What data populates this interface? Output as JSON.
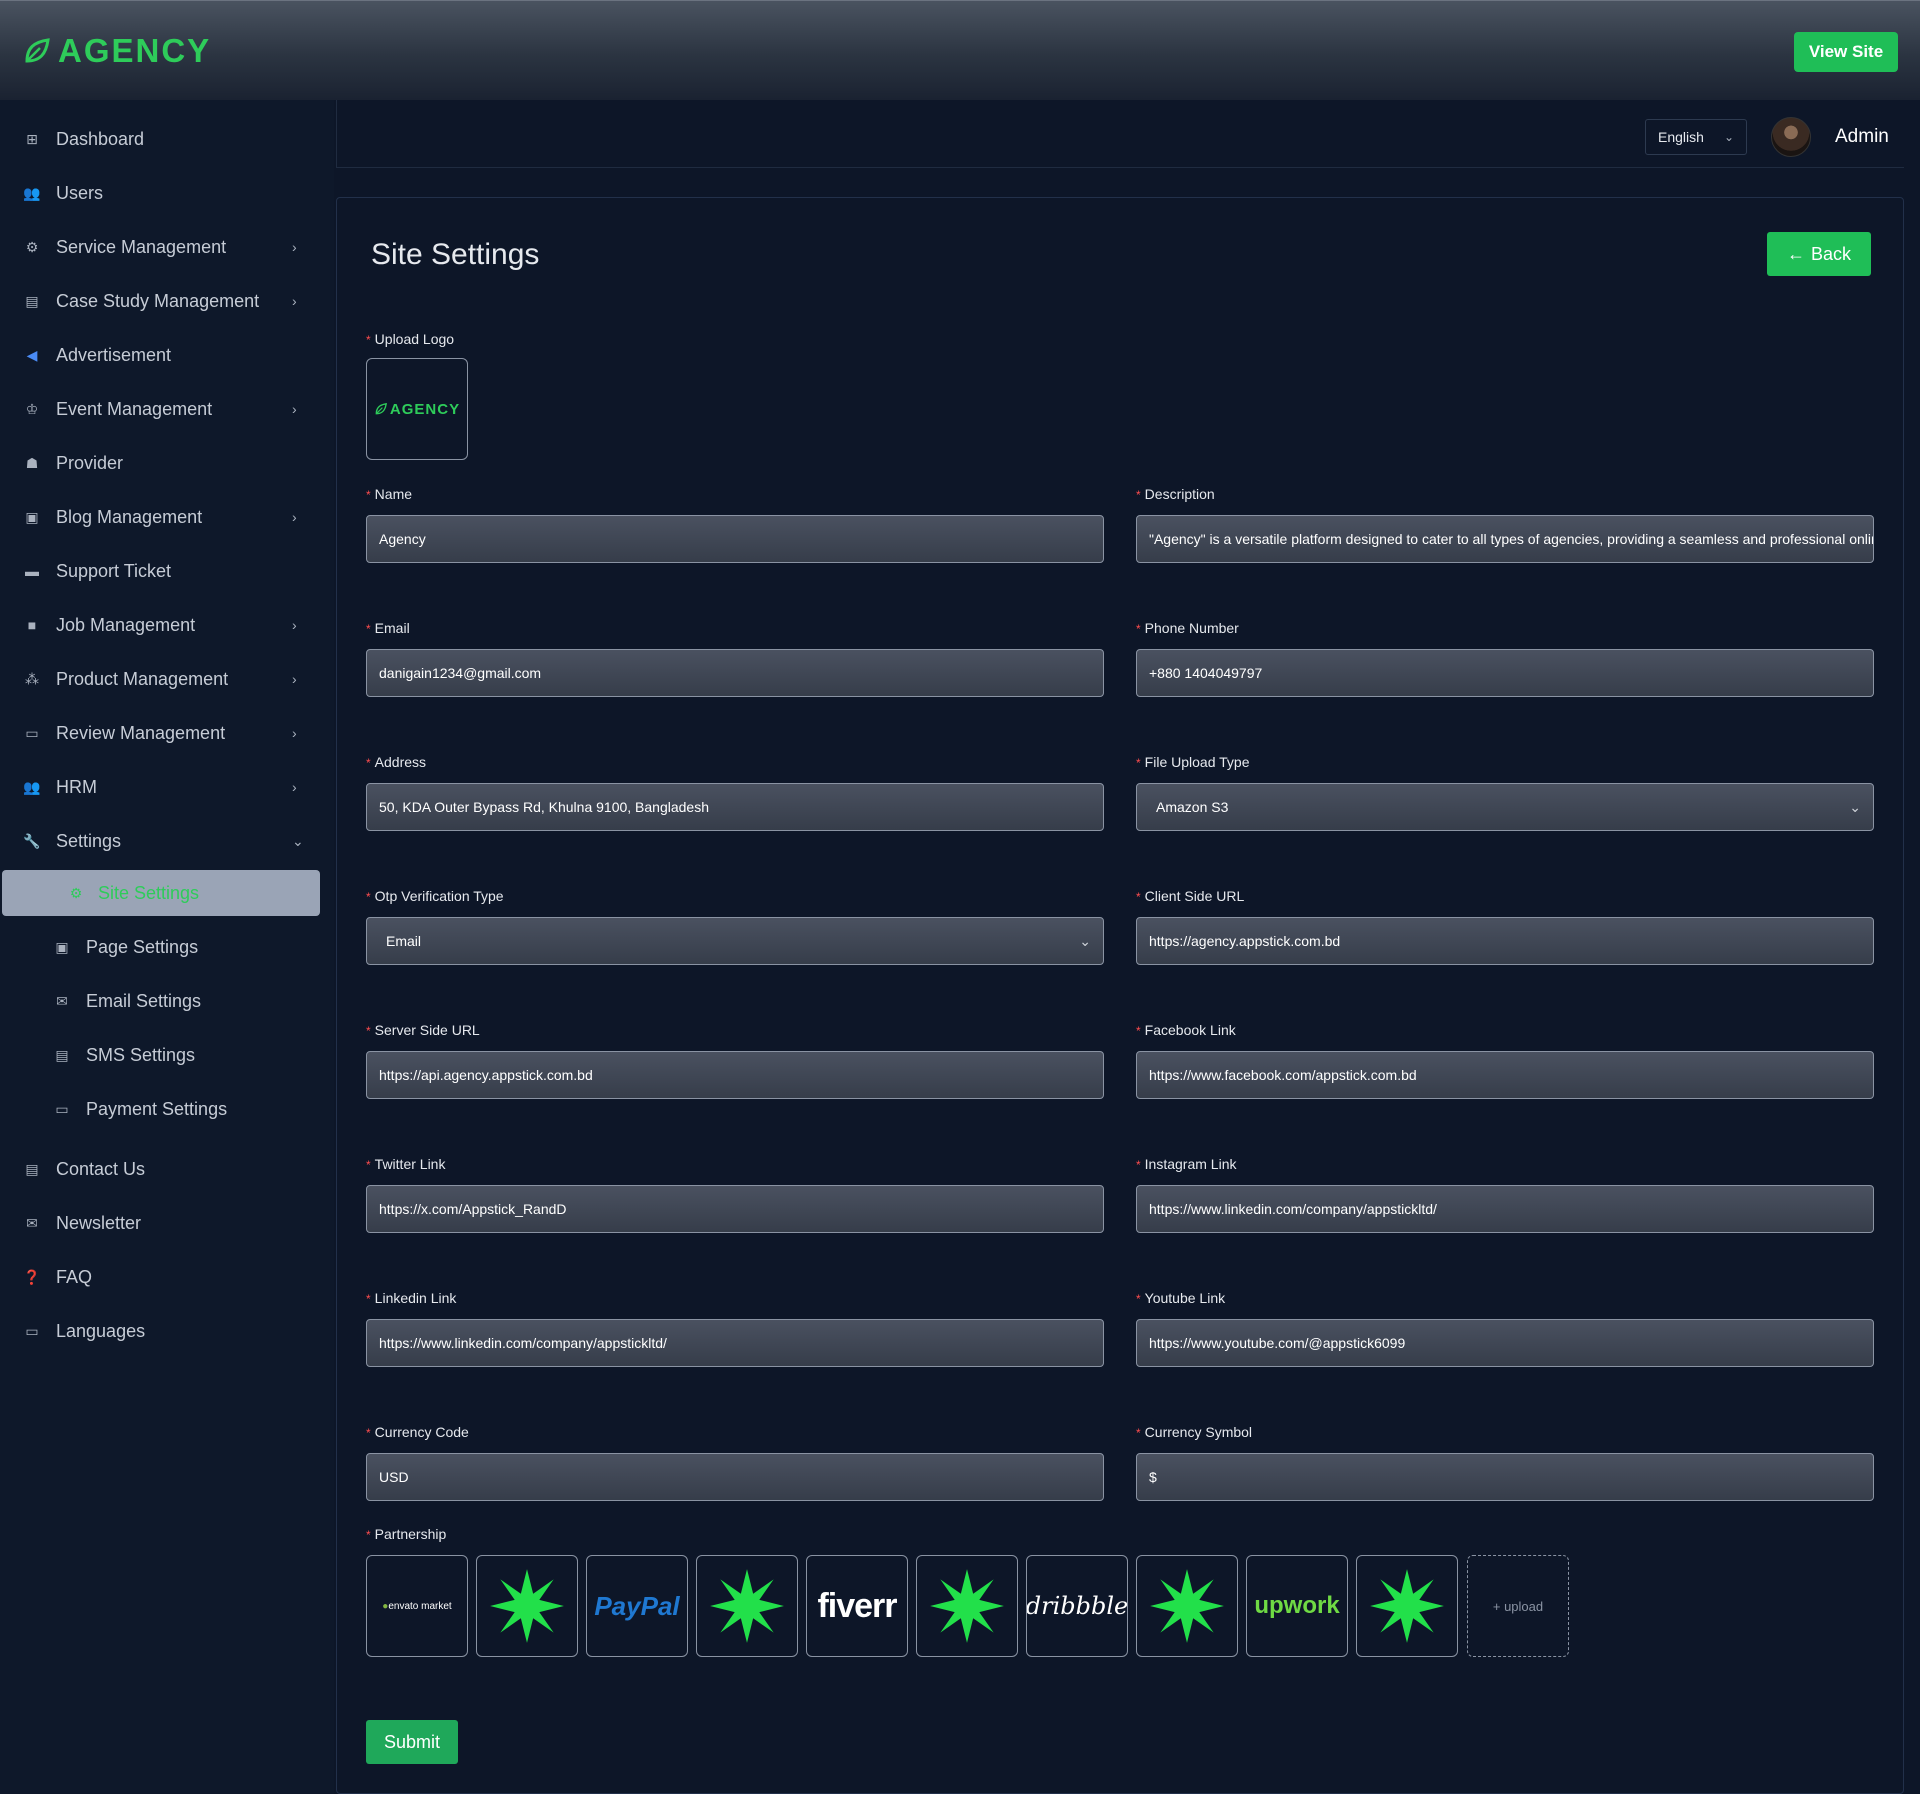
{
  "brand": {
    "name": "AGENCY",
    "color": "#2ecc5a"
  },
  "topbar": {
    "view_site": "View Site"
  },
  "sidebar": {
    "items": [
      {
        "label": "Dashboard",
        "icon": "dashboard-icon"
      },
      {
        "label": "Users",
        "icon": "users-icon"
      },
      {
        "label": "Service Management",
        "icon": "service-icon",
        "chevron": true
      },
      {
        "label": "Case Study Management",
        "icon": "document-icon",
        "chevron": true
      },
      {
        "label": "Advertisement",
        "icon": "megaphone-icon"
      },
      {
        "label": "Event Management",
        "icon": "trophy-icon",
        "chevron": true
      },
      {
        "label": "Provider",
        "icon": "provider-icon"
      },
      {
        "label": "Blog Management",
        "icon": "blog-icon",
        "chevron": true
      },
      {
        "label": "Support Ticket",
        "icon": "ticket-icon"
      },
      {
        "label": "Job Management",
        "icon": "briefcase-icon",
        "chevron": true
      },
      {
        "label": "Product Management",
        "icon": "product-icon",
        "chevron": true
      },
      {
        "label": "Review Management",
        "icon": "review-icon",
        "chevron": true
      },
      {
        "label": "HRM",
        "icon": "team-icon",
        "chevron": true
      },
      {
        "label": "Settings",
        "icon": "wrench-icon",
        "chevron": true
      }
    ],
    "settings_sub": [
      {
        "label": "Site Settings",
        "icon": "gear-icon",
        "active": true
      },
      {
        "label": "Page Settings",
        "icon": "page-icon"
      },
      {
        "label": "Email Settings",
        "icon": "email-icon"
      },
      {
        "label": "SMS Settings",
        "icon": "sms-icon"
      },
      {
        "label": "Payment Settings",
        "icon": "card-icon"
      }
    ],
    "bottom": [
      {
        "label": "Contact Us",
        "icon": "contact-icon"
      },
      {
        "label": "Newsletter",
        "icon": "mail-icon"
      },
      {
        "label": "FAQ",
        "icon": "question-icon"
      },
      {
        "label": "Languages",
        "icon": "languages-icon"
      }
    ]
  },
  "header": {
    "language": "English",
    "user": "Admin"
  },
  "page": {
    "title": "Site Settings",
    "back": "Back",
    "upload_logo_label": "Upload Logo",
    "logo_text": "AGENCY",
    "fields": {
      "name": {
        "label": "Name",
        "value": "Agency"
      },
      "description": {
        "label": "Description",
        "value": "\"Agency\" is a versatile platform designed to cater to all types of agencies, providing a seamless and professional online"
      },
      "email": {
        "label": "Email",
        "value": "danigain1234@gmail.com"
      },
      "phone": {
        "label": "Phone Number",
        "value": "+880 1404049797"
      },
      "address": {
        "label": "Address",
        "value": "50, KDA Outer Bypass Rd, Khulna 9100, Bangladesh"
      },
      "file_upload_type": {
        "label": "File Upload Type",
        "value": "Amazon S3"
      },
      "otp_type": {
        "label": "Otp Verification Type",
        "value": "Email"
      },
      "client_url": {
        "label": "Client Side URL",
        "value": "https://agency.appstick.com.bd"
      },
      "server_url": {
        "label": "Server Side URL",
        "value": "https://api.agency.appstick.com.bd"
      },
      "facebook": {
        "label": "Facebook Link",
        "value": "https://www.facebook.com/appstick.com.bd"
      },
      "twitter": {
        "label": "Twitter Link",
        "value": "https://x.com/Appstick_RandD"
      },
      "instagram": {
        "label": "Instagram Link",
        "value": "https://www.linkedin.com/company/appstickltd/"
      },
      "linkedin": {
        "label": "Linkedin Link",
        "value": "https://www.linkedin.com/company/appstickltd/"
      },
      "youtube": {
        "label": "Youtube Link",
        "value": "https://www.youtube.com/@appstick6099"
      },
      "currency_code": {
        "label": "Currency Code",
        "value": "USD"
      },
      "currency_symbol": {
        "label": "Currency Symbol",
        "value": "$"
      }
    },
    "partnership_label": "Partnership",
    "partners": [
      {
        "name": "envato-logo",
        "text": "envato market"
      },
      {
        "name": "starburst-logo"
      },
      {
        "name": "paypal-logo",
        "text": "PayPal"
      },
      {
        "name": "starburst-logo"
      },
      {
        "name": "fiverr-logo",
        "text": "fiverr"
      },
      {
        "name": "starburst-logo"
      },
      {
        "name": "dribbble-logo",
        "text": "dribbble"
      },
      {
        "name": "starburst-logo"
      },
      {
        "name": "upwork-logo",
        "text": "upwork"
      },
      {
        "name": "starburst-logo"
      }
    ],
    "upload_label": "+ upload",
    "submit": "Submit"
  }
}
